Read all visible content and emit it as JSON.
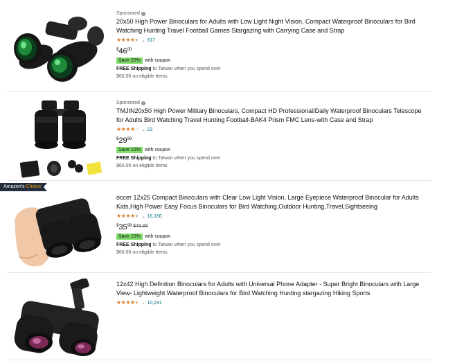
{
  "results": [
    {
      "sponsored_label": "Sponsored",
      "title": "20x50 High Power Binoculars for Adults with Low Light Night Vision, Compact Waterproof Binoculars for Bird Watching Hunting Travel Football Games Stargazing with Carrying Case and Strap",
      "rating": 4.5,
      "stars_text": "★★★★★",
      "review_count": "817",
      "price_symbol": "$",
      "price_whole": "46",
      "price_fraction": "00",
      "coupon_badge": "Save 20%",
      "coupon_text": "with coupon",
      "shipping_bold": "FREE Shipping",
      "shipping_text": " to Taiwan when you spend over $60.00 on eligible items"
    },
    {
      "sponsored_label": "Sponsored",
      "title": "TMJIN20x50 High Power Military Binoculars, Compact HD Professional/Daily Waterproof Binoculars Telescope for Adults Bird Watching Travel Hunting Football-BAK4 Prism FMC Lens-with Case and Strap",
      "rating": 4.0,
      "stars_text": "★★★★★",
      "review_count": "23",
      "price_symbol": "$",
      "price_whole": "29",
      "price_fraction": "99",
      "coupon_badge": "Save 15%",
      "coupon_text": "with coupon",
      "shipping_bold": "FREE Shipping",
      "shipping_text": " to Taiwan when you spend over $60.00 on eligible items"
    },
    {
      "badge_part1": "Amazon's",
      "badge_part2": "Choice",
      "title": "occer 12x25 Compact Binoculars with Clear Low Light Vision, Large Eyepiece Waterproof Binocular for Adults Kids,High Power Easy Focus Binoculars for Bird Watching,Outdoor Hunting,Travel,Sightseeing",
      "rating": 4.5,
      "stars_text": "★★★★★",
      "review_count": "16,150",
      "price_symbol": "$",
      "price_whole": "35",
      "price_fraction": "99",
      "list_price": "$45.89",
      "coupon_badge": "Save 15%",
      "coupon_text": "with coupon",
      "shipping_bold": "FREE Shipping",
      "shipping_text": " to Taiwan when you spend over $60.00 on eligible items"
    },
    {
      "title": "12x42 High Definition Binoculars for Adults with Universal Phone Adapter - Super Bright Binoculars with Large View- Lightweight Waterproof Binoculars  for Bird Watching Hunting stargazing Hiking Sports",
      "rating": 4.5,
      "stars_text": "★★★★★",
      "review_count": "10,241"
    }
  ],
  "icons": {
    "info": "i",
    "chevron": "⌄"
  },
  "colors": {
    "star": "#de7921",
    "link": "#007185",
    "coupon_bg": "#7fda69",
    "choice_bg": "#232f3e",
    "choice_accent": "#ff9900"
  }
}
